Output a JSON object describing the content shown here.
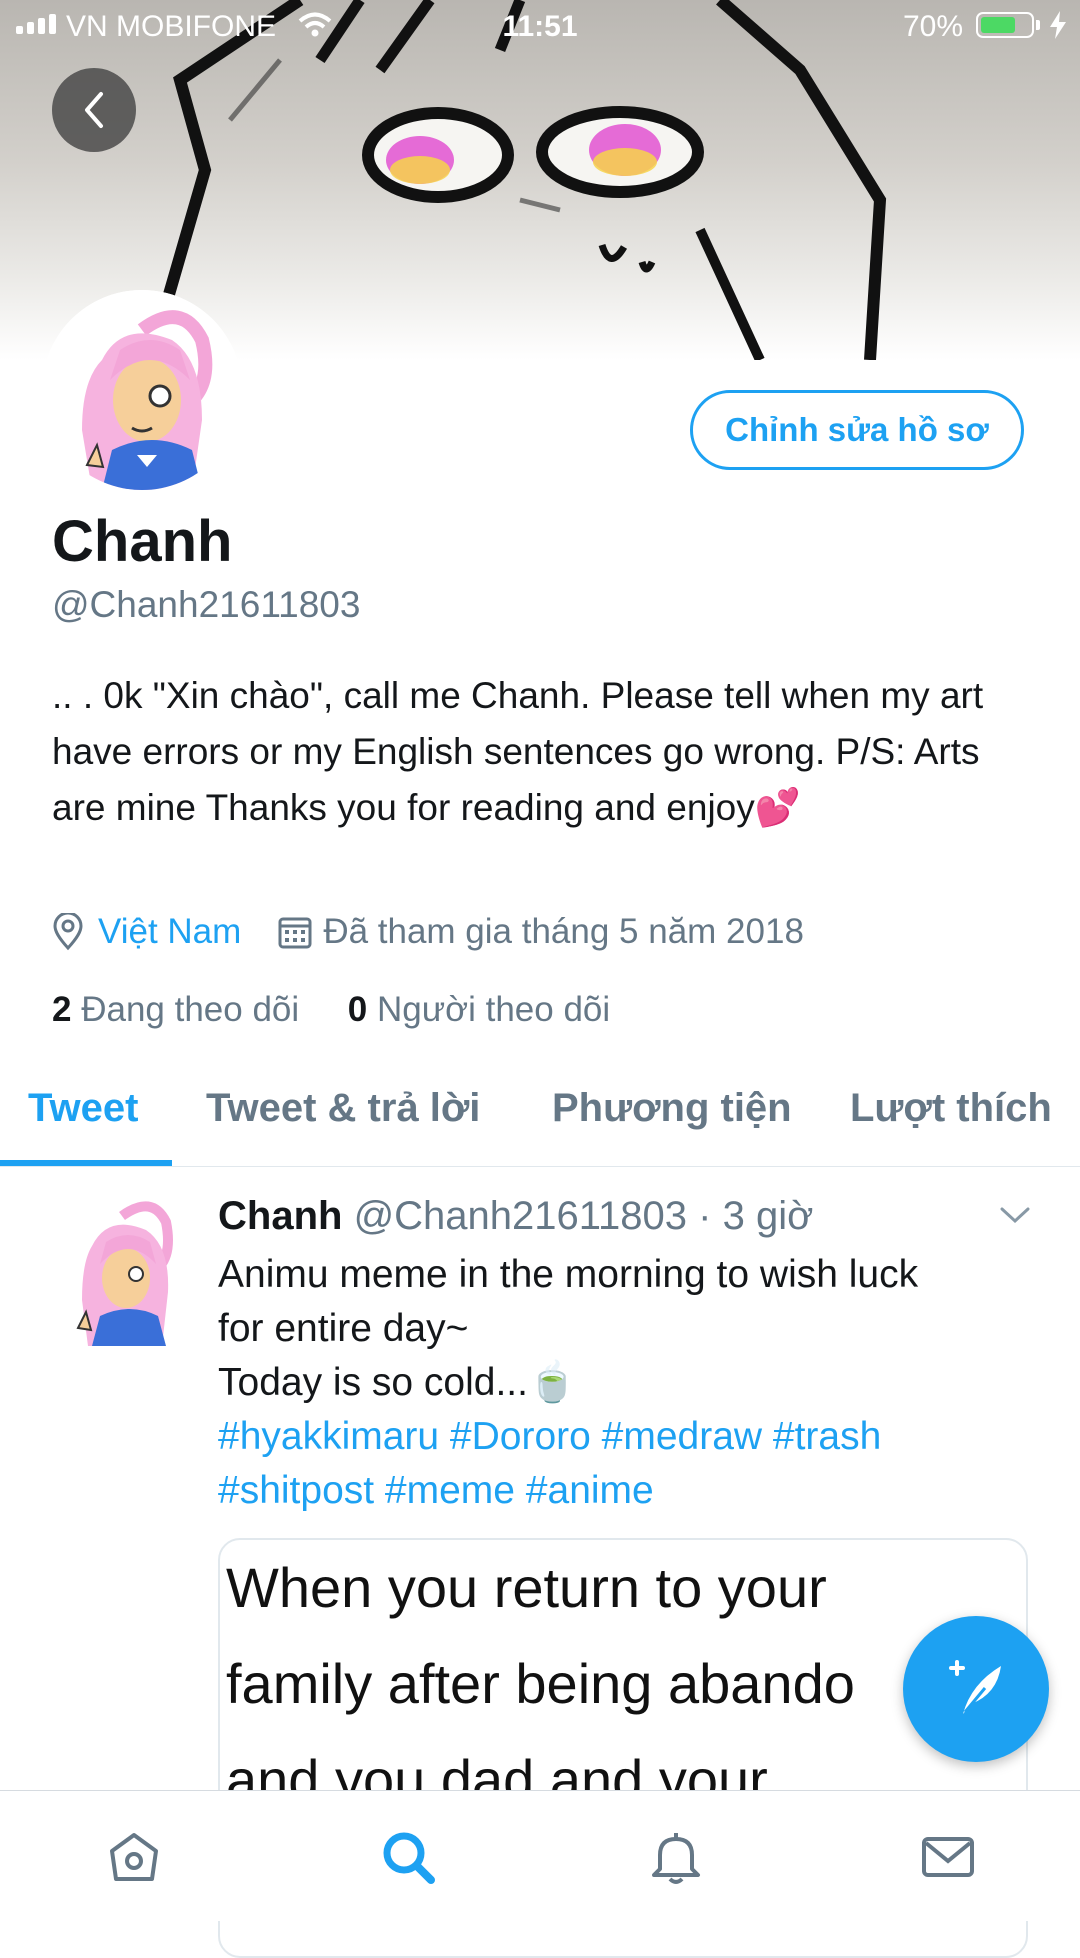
{
  "status_bar": {
    "carrier": "VN MOBIFONE",
    "time": "11:51",
    "battery_percent": "70%",
    "battery_level": 0.7
  },
  "profile": {
    "name": "Chanh",
    "handle": "@Chanh21611803",
    "edit_button": "Chỉnh sửa hồ sơ",
    "bio": ".. . 0k \"Xin chào\", call me Chanh. Please tell when my art have errors or my English sentences go wrong. P/S: Arts are mine Thanks you for reading and enjoy💕",
    "location": "Việt Nam",
    "joined": "Đã tham gia tháng 5 năm 2018",
    "following_count": "2",
    "following_label": "Đang theo dõi",
    "followers_count": "0",
    "followers_label": "Người theo dõi"
  },
  "tabs": [
    {
      "label": "Tweet"
    },
    {
      "label": "Tweet & trả lời"
    },
    {
      "label": "Phương tiện"
    },
    {
      "label": "Lượt thích"
    }
  ],
  "tweet": {
    "name": "Chanh",
    "handle": "@Chanh21611803",
    "time": "· 3 giờ",
    "line1": "Animu meme in the morning to wish luck",
    "line2": "for entire day~",
    "line3": "Today is so cold...🍵",
    "hashtags1": "#hyakkimaru #Dororo #medraw #trash",
    "hashtags2": "#shitpost #meme #anime",
    "media_text": [
      "When you return to your",
      "family after being abando",
      "and you dad and your"
    ]
  },
  "colors": {
    "accent": "#1da1f2",
    "muted": "#657786",
    "text": "#14171a"
  },
  "icons": {
    "nav": [
      "home-icon",
      "search-icon",
      "bell-icon",
      "mail-icon"
    ],
    "active_nav": "search-icon"
  }
}
